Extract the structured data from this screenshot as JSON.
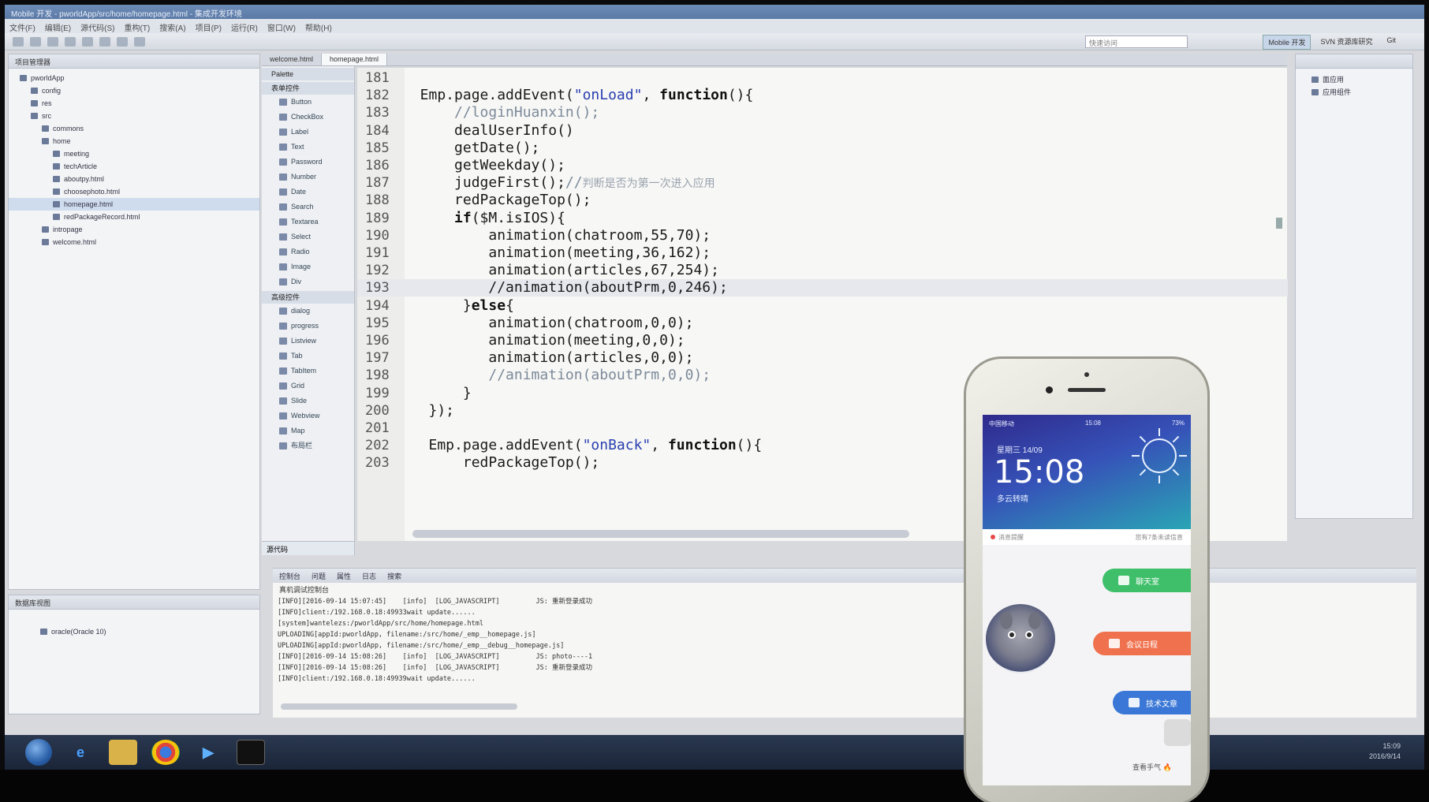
{
  "window": {
    "title": "Mobile 开发 - pworldApp/src/home/homepage.html - 集成开发环境",
    "menu": [
      "文件(F)",
      "编辑(E)",
      "源代码(S)",
      "重构(T)",
      "搜索(A)",
      "项目(P)",
      "运行(R)",
      "窗口(W)",
      "帮助(H)"
    ],
    "quick_access_placeholder": "快速访问",
    "perspectives": [
      "Mobile 开发",
      "SVN 资源库研究",
      "Git"
    ]
  },
  "explorer": {
    "tab_label": "项目管理器",
    "items": [
      {
        "label": "pworldApp",
        "indent": 0
      },
      {
        "label": "config",
        "indent": 1
      },
      {
        "label": "res",
        "indent": 1
      },
      {
        "label": "src",
        "indent": 1
      },
      {
        "label": "commons",
        "indent": 2
      },
      {
        "label": "home",
        "indent": 2
      },
      {
        "label": "meeting",
        "indent": 3
      },
      {
        "label": "techArticle",
        "indent": 3
      },
      {
        "label": "aboutpy.html",
        "indent": 3
      },
      {
        "label": "choosephoto.html",
        "indent": 3
      },
      {
        "label": "homepage.html",
        "indent": 3,
        "selected": true
      },
      {
        "label": "redPackageRecord.html",
        "indent": 3
      },
      {
        "label": "intropage",
        "indent": 2
      },
      {
        "label": "welcome.html",
        "indent": 2
      }
    ]
  },
  "servers": {
    "tab_label": "数据库视图",
    "item": "oracle(Oracle 10)"
  },
  "editor_tabs": [
    {
      "label": "welcome.html",
      "active": false
    },
    {
      "label": "homepage.html",
      "active": true
    }
  ],
  "palette": {
    "title": "Palette",
    "group1": "表单控件",
    "group1_items": [
      "Button",
      "CheckBox",
      "Label",
      "Text",
      "Password",
      "Number",
      "Date",
      "Search",
      "Textarea",
      "Select",
      "Radio",
      "Image",
      "Div"
    ],
    "group2": "高级控件",
    "group2_items": [
      "dialog",
      "progress",
      "Listview",
      "Tab",
      "TabItem",
      "Grid",
      "Slide",
      "Webview",
      "Map",
      "布局栏"
    ],
    "footer": "源代码"
  },
  "code": {
    "current_line": 193,
    "lines": [
      {
        "n": "181",
        "segments": []
      },
      {
        "n": "182",
        "segments": [
          {
            "t": "  Emp.page.addEvent(",
            "c": ""
          },
          {
            "t": "\"onLoad\"",
            "c": "str"
          },
          {
            "t": ", ",
            "c": ""
          },
          {
            "t": "function",
            "c": "kw"
          },
          {
            "t": "(){",
            "c": ""
          }
        ]
      },
      {
        "n": "183",
        "segments": [
          {
            "t": "      //loginHuanxin();",
            "c": "cm"
          }
        ]
      },
      {
        "n": "184",
        "segments": [
          {
            "t": "      dealUserInfo()",
            "c": ""
          }
        ]
      },
      {
        "n": "185",
        "segments": [
          {
            "t": "      getDate();",
            "c": ""
          }
        ]
      },
      {
        "n": "186",
        "segments": [
          {
            "t": "      getWeekday();",
            "c": ""
          }
        ]
      },
      {
        "n": "187",
        "segments": [
          {
            "t": "      judgeFirst();",
            "c": ""
          },
          {
            "t": "//",
            "c": "cm"
          },
          {
            "t": "判断是否为第一次进入应用",
            "c": "cm-cn"
          }
        ]
      },
      {
        "n": "188",
        "segments": [
          {
            "t": "      redPackageTop();",
            "c": ""
          }
        ]
      },
      {
        "n": "189",
        "segments": [
          {
            "t": "      ",
            "c": ""
          },
          {
            "t": "if",
            "c": "kw"
          },
          {
            "t": "($M.isIOS){",
            "c": ""
          }
        ]
      },
      {
        "n": "190",
        "segments": [
          {
            "t": "          animation(chatroom,55,70);",
            "c": ""
          }
        ]
      },
      {
        "n": "191",
        "segments": [
          {
            "t": "          animation(meeting,36,162);",
            "c": ""
          }
        ]
      },
      {
        "n": "192",
        "segments": [
          {
            "t": "          animation(articles,67,254);",
            "c": ""
          }
        ]
      },
      {
        "n": "193",
        "segments": [
          {
            "t": "          ",
            "c": ""
          },
          {
            "t": "//animation(aboutPrm,0,246);",
            "c": ""
          }
        ]
      },
      {
        "n": "194",
        "segments": [
          {
            "t": "       }",
            "c": ""
          },
          {
            "t": "else",
            "c": "kw"
          },
          {
            "t": "{",
            "c": ""
          }
        ]
      },
      {
        "n": "195",
        "segments": [
          {
            "t": "          animation(chatroom,0,0);",
            "c": ""
          }
        ]
      },
      {
        "n": "196",
        "segments": [
          {
            "t": "          animation(meeting,0,0);",
            "c": ""
          }
        ]
      },
      {
        "n": "197",
        "segments": [
          {
            "t": "          animation(articles,0,0);",
            "c": ""
          }
        ]
      },
      {
        "n": "198",
        "segments": [
          {
            "t": "          //animation(aboutPrm,0,0);",
            "c": "cm"
          }
        ]
      },
      {
        "n": "199",
        "segments": [
          {
            "t": "       }",
            "c": ""
          }
        ]
      },
      {
        "n": "200",
        "segments": [
          {
            "t": "   });",
            "c": ""
          }
        ]
      },
      {
        "n": "201",
        "segments": []
      },
      {
        "n": "202",
        "segments": [
          {
            "t": "   Emp.page.addEvent(",
            "c": ""
          },
          {
            "t": "\"onBack\"",
            "c": "str"
          },
          {
            "t": ", ",
            "c": ""
          },
          {
            "t": "function",
            "c": "kw"
          },
          {
            "t": "(){",
            "c": ""
          }
        ]
      },
      {
        "n": "203",
        "segments": [
          {
            "t": "       redPackageTop();",
            "c": ""
          }
        ]
      }
    ]
  },
  "outline": {
    "items": [
      "面应用",
      "应用组件"
    ]
  },
  "console": {
    "tabs": [
      "控制台",
      "问题",
      "属性",
      "日志",
      "搜索"
    ],
    "title": "真机调试控制台",
    "lines": [
      "[INFO][2016-09-14 15:07:45]    [info]  [LOG_JAVASCRIPT]         JS: 重新登录成功",
      "[INFO]client:/192.168.0.18:49933wait update......",
      "[system]wantelezs:/pworldApp/src/home/homepage.html",
      "UPLOADING[appId:pworldApp, filename:/src/home/_emp__homepage.js]",
      "UPLOADING[appId:pworldApp, filename:/src/home/_emp__debug__homepage.js]",
      "[INFO][2016-09-14 15:08:26]    [info]  [LOG_JAVASCRIPT]         JS: photo----1",
      "[INFO][2016-09-14 15:08:26]    [info]  [LOG_JAVASCRIPT]         JS: 重新登录成功",
      "[INFO]client:/192.168.0.18:49939wait update......"
    ]
  },
  "taskbar": {
    "time": "15:09",
    "date": "2016/9/14"
  },
  "phone": {
    "carrier": "中国移动",
    "status_time": "15:08",
    "battery": "73%",
    "date_line": "星期三  14/09",
    "big_time": "15:08",
    "weather": "多云转晴",
    "info_left": "消息提醒",
    "info_right": "您有7条未读信息",
    "btn_chatroom": "聊天室",
    "btn_meeting": "会议日程",
    "btn_articles": "技术文章",
    "bottom_text": "查看手气"
  },
  "colors": {
    "pill_green": "#3fbf6a",
    "pill_orange": "#f0714d",
    "pill_blue": "#3a77d6",
    "string_literal": "#2a3fb0"
  }
}
